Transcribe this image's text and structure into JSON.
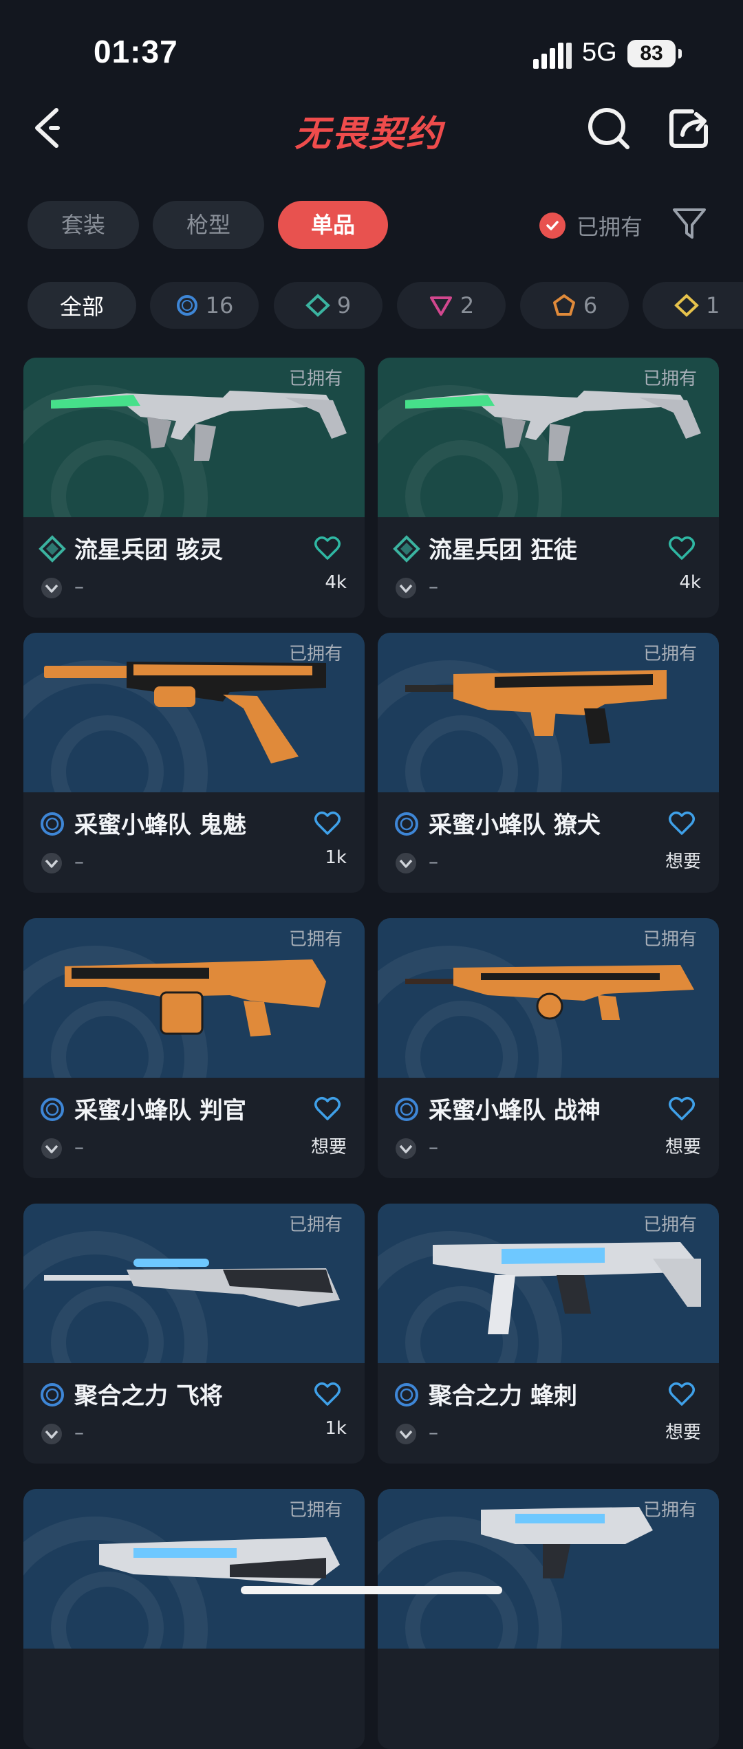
{
  "status": {
    "time": "01:37",
    "network": "5G",
    "battery": "83"
  },
  "nav": {
    "title": "无畏契约",
    "icons": [
      "back-icon",
      "search-icon",
      "share-icon"
    ]
  },
  "tabs": [
    {
      "label": "套装",
      "active": false
    },
    {
      "label": "枪型",
      "active": false
    },
    {
      "label": "单品",
      "active": true
    }
  ],
  "owned_filter": {
    "label": "已拥有",
    "checked": true
  },
  "tier_filters": [
    {
      "label": "全部"
    },
    {
      "icon": "tier-circle-blue-icon",
      "count": "16"
    },
    {
      "icon": "tier-diamond-teal-icon",
      "count": "9"
    },
    {
      "icon": "tier-triangle-pink-icon",
      "count": "2"
    },
    {
      "icon": "tier-pentagon-orange-icon",
      "count": "6"
    },
    {
      "icon": "tier-diamond-gold-icon",
      "count": "1"
    }
  ],
  "cards": [
    {
      "title": "流星兵团 骇灵",
      "owned": "已拥有",
      "sub": "–",
      "count": "4k",
      "tier": "teal",
      "bg": "green",
      "weapon": "vandal"
    },
    {
      "title": "流星兵团 狂徒",
      "owned": "已拥有",
      "sub": "–",
      "count": "4k",
      "tier": "teal",
      "bg": "green",
      "weapon": "vandal"
    },
    {
      "title": "采蜜小蜂队 鬼魅",
      "owned": "已拥有",
      "sub": "–",
      "count": "1k",
      "tier": "blue",
      "bg": "blue",
      "weapon": "pistol"
    },
    {
      "title": "采蜜小蜂队 獠犬",
      "owned": "已拥有",
      "sub": "–",
      "count": "想要",
      "tier": "blue",
      "bg": "blue",
      "weapon": "bulldog"
    },
    {
      "title": "采蜜小蜂队 判官",
      "owned": "已拥有",
      "sub": "–",
      "count": "想要",
      "tier": "blue",
      "bg": "blue",
      "weapon": "judge"
    },
    {
      "title": "采蜜小蜂队 战神",
      "owned": "已拥有",
      "sub": "–",
      "count": "想要",
      "tier": "blue",
      "bg": "blue",
      "weapon": "ares"
    },
    {
      "title": "聚合之力 飞将",
      "owned": "已拥有",
      "sub": "–",
      "count": "1k",
      "tier": "blue",
      "bg": "blue",
      "weapon": "marshal"
    },
    {
      "title": "聚合之力 蜂刺",
      "owned": "已拥有",
      "sub": "–",
      "count": "想要",
      "tier": "blue",
      "bg": "blue",
      "weapon": "stinger"
    },
    {
      "title": "",
      "owned": "已拥有",
      "sub": "",
      "count": "",
      "tier": "blue",
      "bg": "blue",
      "weapon": "rifle"
    },
    {
      "title": "",
      "owned": "已拥有",
      "sub": "",
      "count": "",
      "tier": "blue",
      "bg": "blue",
      "weapon": "smg"
    }
  ],
  "colors": {
    "accent": "#e8524f",
    "heart": "#3fa0e8",
    "heart_teal": "#2fb7a3",
    "tier_blue": "#3e86d6",
    "tier_teal": "#3bb3a0"
  }
}
